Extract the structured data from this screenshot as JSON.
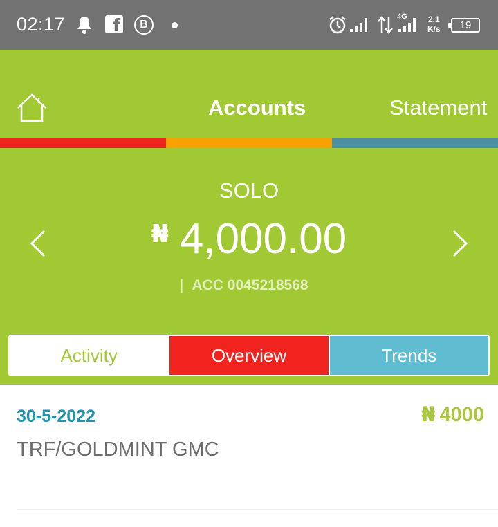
{
  "status_bar": {
    "time": "02:17",
    "network_type": "4G",
    "speed_value": "2.1",
    "speed_unit": "K/s",
    "battery": "19"
  },
  "nav": {
    "home_icon": "home-icon",
    "tabs": [
      {
        "label": "Accounts",
        "active": true
      },
      {
        "label": "Statement",
        "active": false
      }
    ]
  },
  "account": {
    "name": "SOLO",
    "currency_symbol": "₦",
    "balance": "4,000.00",
    "number_prefix": "|",
    "number": "ACC 0045218568"
  },
  "segments": {
    "activity": "Activity",
    "overview": "Overview",
    "trends": "Trends"
  },
  "transactions": [
    {
      "date": "30-5-2022",
      "currency_symbol": "₦",
      "amount": "4000",
      "description": "TRF/GOLDMINT GMC"
    }
  ],
  "colors": {
    "brand_green": "#a0c934",
    "accent_red": "#f0231e",
    "accent_orange": "#f7a200",
    "accent_blue": "#4d8fa2",
    "trends_blue": "#60bcd0",
    "date_blue": "#1f95b0"
  }
}
